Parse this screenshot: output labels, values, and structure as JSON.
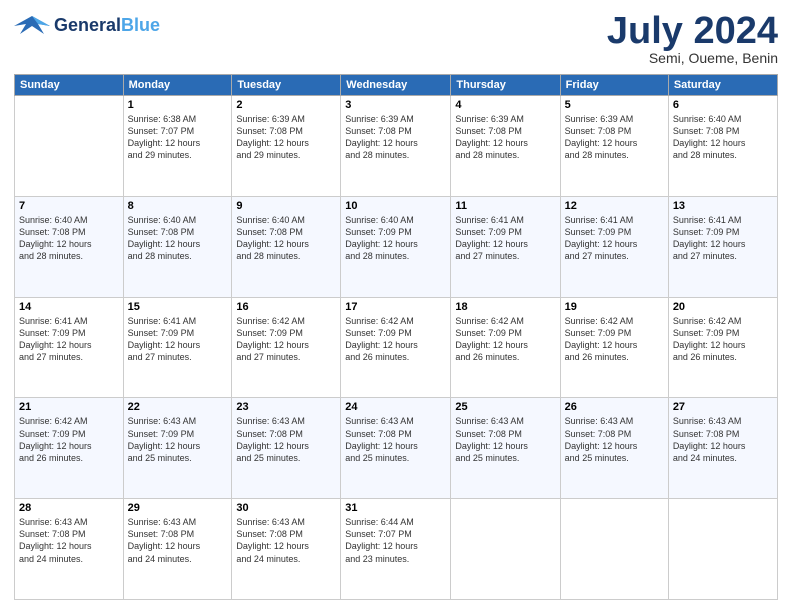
{
  "header": {
    "logo_general": "General",
    "logo_blue": "Blue",
    "title": "July 2024",
    "location": "Semi, Oueme, Benin"
  },
  "days_of_week": [
    "Sunday",
    "Monday",
    "Tuesday",
    "Wednesday",
    "Thursday",
    "Friday",
    "Saturday"
  ],
  "weeks": [
    [
      {
        "day": "",
        "sunrise": "",
        "sunset": "",
        "daylight": ""
      },
      {
        "day": "1",
        "sunrise": "Sunrise: 6:38 AM",
        "sunset": "Sunset: 7:07 PM",
        "daylight": "Daylight: 12 hours and 29 minutes."
      },
      {
        "day": "2",
        "sunrise": "Sunrise: 6:39 AM",
        "sunset": "Sunset: 7:08 PM",
        "daylight": "Daylight: 12 hours and 29 minutes."
      },
      {
        "day": "3",
        "sunrise": "Sunrise: 6:39 AM",
        "sunset": "Sunset: 7:08 PM",
        "daylight": "Daylight: 12 hours and 28 minutes."
      },
      {
        "day": "4",
        "sunrise": "Sunrise: 6:39 AM",
        "sunset": "Sunset: 7:08 PM",
        "daylight": "Daylight: 12 hours and 28 minutes."
      },
      {
        "day": "5",
        "sunrise": "Sunrise: 6:39 AM",
        "sunset": "Sunset: 7:08 PM",
        "daylight": "Daylight: 12 hours and 28 minutes."
      },
      {
        "day": "6",
        "sunrise": "Sunrise: 6:40 AM",
        "sunset": "Sunset: 7:08 PM",
        "daylight": "Daylight: 12 hours and 28 minutes."
      }
    ],
    [
      {
        "day": "7",
        "sunrise": "Sunrise: 6:40 AM",
        "sunset": "Sunset: 7:08 PM",
        "daylight": "Daylight: 12 hours and 28 minutes."
      },
      {
        "day": "8",
        "sunrise": "Sunrise: 6:40 AM",
        "sunset": "Sunset: 7:08 PM",
        "daylight": "Daylight: 12 hours and 28 minutes."
      },
      {
        "day": "9",
        "sunrise": "Sunrise: 6:40 AM",
        "sunset": "Sunset: 7:08 PM",
        "daylight": "Daylight: 12 hours and 28 minutes."
      },
      {
        "day": "10",
        "sunrise": "Sunrise: 6:40 AM",
        "sunset": "Sunset: 7:09 PM",
        "daylight": "Daylight: 12 hours and 28 minutes."
      },
      {
        "day": "11",
        "sunrise": "Sunrise: 6:41 AM",
        "sunset": "Sunset: 7:09 PM",
        "daylight": "Daylight: 12 hours and 27 minutes."
      },
      {
        "day": "12",
        "sunrise": "Sunrise: 6:41 AM",
        "sunset": "Sunset: 7:09 PM",
        "daylight": "Daylight: 12 hours and 27 minutes."
      },
      {
        "day": "13",
        "sunrise": "Sunrise: 6:41 AM",
        "sunset": "Sunset: 7:09 PM",
        "daylight": "Daylight: 12 hours and 27 minutes."
      }
    ],
    [
      {
        "day": "14",
        "sunrise": "Sunrise: 6:41 AM",
        "sunset": "Sunset: 7:09 PM",
        "daylight": "Daylight: 12 hours and 27 minutes."
      },
      {
        "day": "15",
        "sunrise": "Sunrise: 6:41 AM",
        "sunset": "Sunset: 7:09 PM",
        "daylight": "Daylight: 12 hours and 27 minutes."
      },
      {
        "day": "16",
        "sunrise": "Sunrise: 6:42 AM",
        "sunset": "Sunset: 7:09 PM",
        "daylight": "Daylight: 12 hours and 27 minutes."
      },
      {
        "day": "17",
        "sunrise": "Sunrise: 6:42 AM",
        "sunset": "Sunset: 7:09 PM",
        "daylight": "Daylight: 12 hours and 26 minutes."
      },
      {
        "day": "18",
        "sunrise": "Sunrise: 6:42 AM",
        "sunset": "Sunset: 7:09 PM",
        "daylight": "Daylight: 12 hours and 26 minutes."
      },
      {
        "day": "19",
        "sunrise": "Sunrise: 6:42 AM",
        "sunset": "Sunset: 7:09 PM",
        "daylight": "Daylight: 12 hours and 26 minutes."
      },
      {
        "day": "20",
        "sunrise": "Sunrise: 6:42 AM",
        "sunset": "Sunset: 7:09 PM",
        "daylight": "Daylight: 12 hours and 26 minutes."
      }
    ],
    [
      {
        "day": "21",
        "sunrise": "Sunrise: 6:42 AM",
        "sunset": "Sunset: 7:09 PM",
        "daylight": "Daylight: 12 hours and 26 minutes."
      },
      {
        "day": "22",
        "sunrise": "Sunrise: 6:43 AM",
        "sunset": "Sunset: 7:09 PM",
        "daylight": "Daylight: 12 hours and 25 minutes."
      },
      {
        "day": "23",
        "sunrise": "Sunrise: 6:43 AM",
        "sunset": "Sunset: 7:08 PM",
        "daylight": "Daylight: 12 hours and 25 minutes."
      },
      {
        "day": "24",
        "sunrise": "Sunrise: 6:43 AM",
        "sunset": "Sunset: 7:08 PM",
        "daylight": "Daylight: 12 hours and 25 minutes."
      },
      {
        "day": "25",
        "sunrise": "Sunrise: 6:43 AM",
        "sunset": "Sunset: 7:08 PM",
        "daylight": "Daylight: 12 hours and 25 minutes."
      },
      {
        "day": "26",
        "sunrise": "Sunrise: 6:43 AM",
        "sunset": "Sunset: 7:08 PM",
        "daylight": "Daylight: 12 hours and 25 minutes."
      },
      {
        "day": "27",
        "sunrise": "Sunrise: 6:43 AM",
        "sunset": "Sunset: 7:08 PM",
        "daylight": "Daylight: 12 hours and 24 minutes."
      }
    ],
    [
      {
        "day": "28",
        "sunrise": "Sunrise: 6:43 AM",
        "sunset": "Sunset: 7:08 PM",
        "daylight": "Daylight: 12 hours and 24 minutes."
      },
      {
        "day": "29",
        "sunrise": "Sunrise: 6:43 AM",
        "sunset": "Sunset: 7:08 PM",
        "daylight": "Daylight: 12 hours and 24 minutes."
      },
      {
        "day": "30",
        "sunrise": "Sunrise: 6:43 AM",
        "sunset": "Sunset: 7:08 PM",
        "daylight": "Daylight: 12 hours and 24 minutes."
      },
      {
        "day": "31",
        "sunrise": "Sunrise: 6:44 AM",
        "sunset": "Sunset: 7:07 PM",
        "daylight": "Daylight: 12 hours and 23 minutes."
      },
      {
        "day": "",
        "sunrise": "",
        "sunset": "",
        "daylight": ""
      },
      {
        "day": "",
        "sunrise": "",
        "sunset": "",
        "daylight": ""
      },
      {
        "day": "",
        "sunrise": "",
        "sunset": "",
        "daylight": ""
      }
    ]
  ]
}
